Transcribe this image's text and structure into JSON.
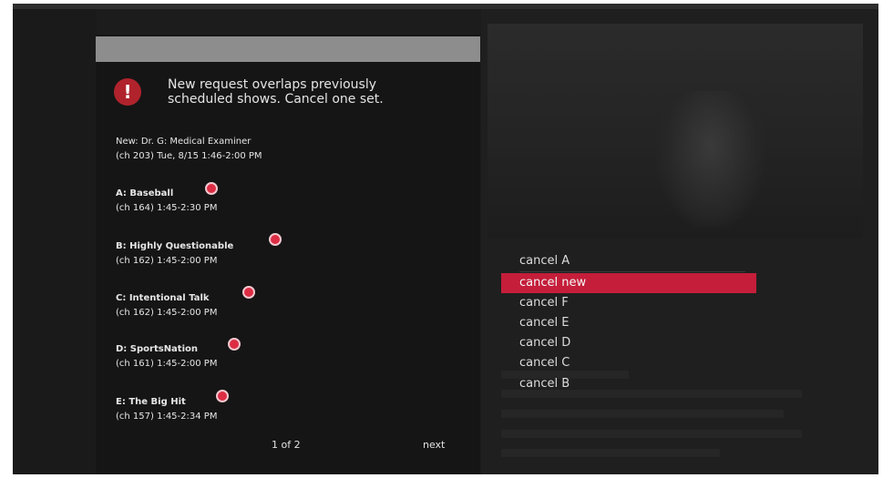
{
  "dialog": {
    "message_line1": "New request overlaps previously",
    "message_line2": "scheduled shows. Cancel one set.",
    "new_show": {
      "label": "New:",
      "title": "Dr. G: Medical Examiner",
      "schedule": "(ch 203) Tue, 8/15  1:46-2:00 PM"
    },
    "conflicts": [
      {
        "label": "A:",
        "title": "Baseball",
        "schedule": "(ch 164) 1:45-2:30 PM"
      },
      {
        "label": "B:",
        "title": "Highly Questionable",
        "schedule": "(ch 162) 1:45-2:00 PM"
      },
      {
        "label": "C:",
        "title": "Intentional Talk",
        "schedule": "(ch 162) 1:45-2:00 PM"
      },
      {
        "label": "D:",
        "title": "SportsNation",
        "schedule": "(ch 161) 1:45-2:00 PM"
      },
      {
        "label": "E:",
        "title": "The Big Hit",
        "schedule": "(ch 157) 1:45-2:34 PM"
      }
    ],
    "page_indicator": "1 of 2",
    "next_label": "next"
  },
  "options": [
    {
      "label": "cancel A",
      "selected": false
    },
    {
      "label": "cancel new",
      "selected": true
    },
    {
      "label": "cancel F",
      "selected": false
    },
    {
      "label": "cancel E",
      "selected": false
    },
    {
      "label": "cancel D",
      "selected": false
    },
    {
      "label": "cancel C",
      "selected": false
    },
    {
      "label": "cancel B",
      "selected": false
    }
  ],
  "colors": {
    "accent": "#c41e3a",
    "record_dot": "#dc2d44",
    "alert_icon": "#b0232c",
    "header_bar": "#8d8d8d"
  },
  "icons": {
    "alert": "exclamation-circle-icon",
    "record": "record-dot-icon"
  }
}
